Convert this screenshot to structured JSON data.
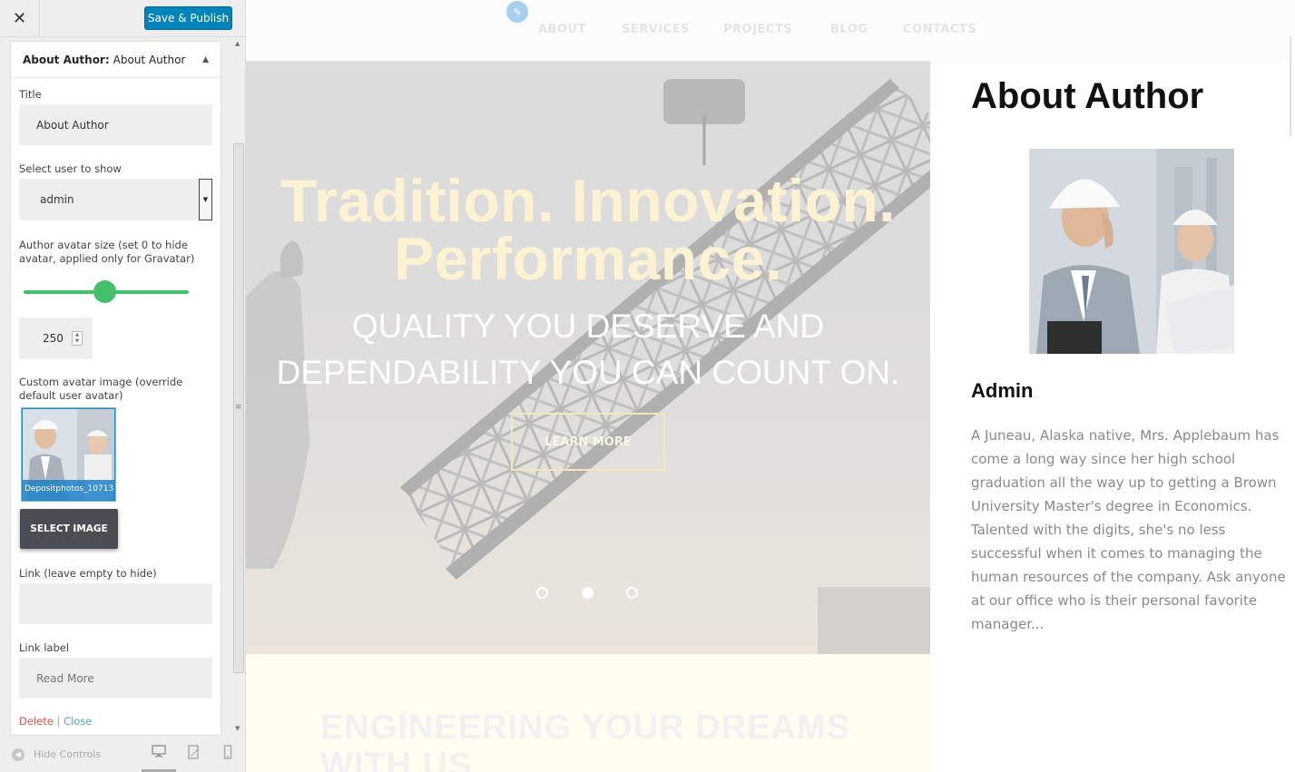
{
  "sidebar": {
    "close_icon": "close-icon",
    "publish_label": "Save & Publish",
    "widget": {
      "type_label": "About Author:",
      "title_label": "About Author",
      "fields": {
        "title_label": "Title",
        "title_value": "About Author",
        "user_label": "Select user to show",
        "user_value": "admin",
        "avatar_size_label": "Author avatar size (set 0 to hide avatar, applied only for Gravatar)",
        "avatar_size_value": "250",
        "avatar_size_slider_fraction": 0.5,
        "custom_avatar_label": "Custom avatar image (override default user avatar)",
        "avatar_filename": "Depositphotos_10713",
        "select_image_label": "SELECT IMAGE",
        "link_label": "Link (leave empty to hide)",
        "link_value": "",
        "link_text_label": "Link label",
        "link_text_placeholder": "Read More"
      },
      "delete_label": "Delete",
      "separator": "|",
      "close_label": "Close"
    },
    "footer": {
      "hide_label": "Hide Controls",
      "devices": [
        "desktop-icon",
        "tablet-icon",
        "mobile-icon"
      ]
    }
  },
  "preview": {
    "nav": [
      "ABOUT",
      "SERVICES",
      "PROJECTS",
      "BLOG",
      "CONTACTS"
    ],
    "hero": {
      "title_line1": "Tradition. Innovation.",
      "title_line2": "Performance.",
      "subtitle_line1": "QUALITY YOU DESERVE AND",
      "subtitle_line2": "DEPENDABILITY YOU CAN COUNT ON.",
      "button": "LEARN MORE",
      "slides": 3,
      "active_slide": 2
    },
    "section_title": "ENGINEERING YOUR DREAMS WITH US",
    "about": {
      "heading": "About Author",
      "name": "Admin",
      "bio": "A Juneau, Alaska native, Mrs. Applebaum has come a long way since her high school graduation all the way up to getting a Brown University Master's degree in Economics. Talented with the digits, she's no less successful when it comes to managing the human resources of the company. Ask anyone at our office who is their personal favorite manager..."
    }
  },
  "colors": {
    "publish": "#0085ba",
    "slider": "#45c06a",
    "delete": "#d9534f",
    "close": "#4fa8d8",
    "hero_title": "#fdf3d3"
  }
}
